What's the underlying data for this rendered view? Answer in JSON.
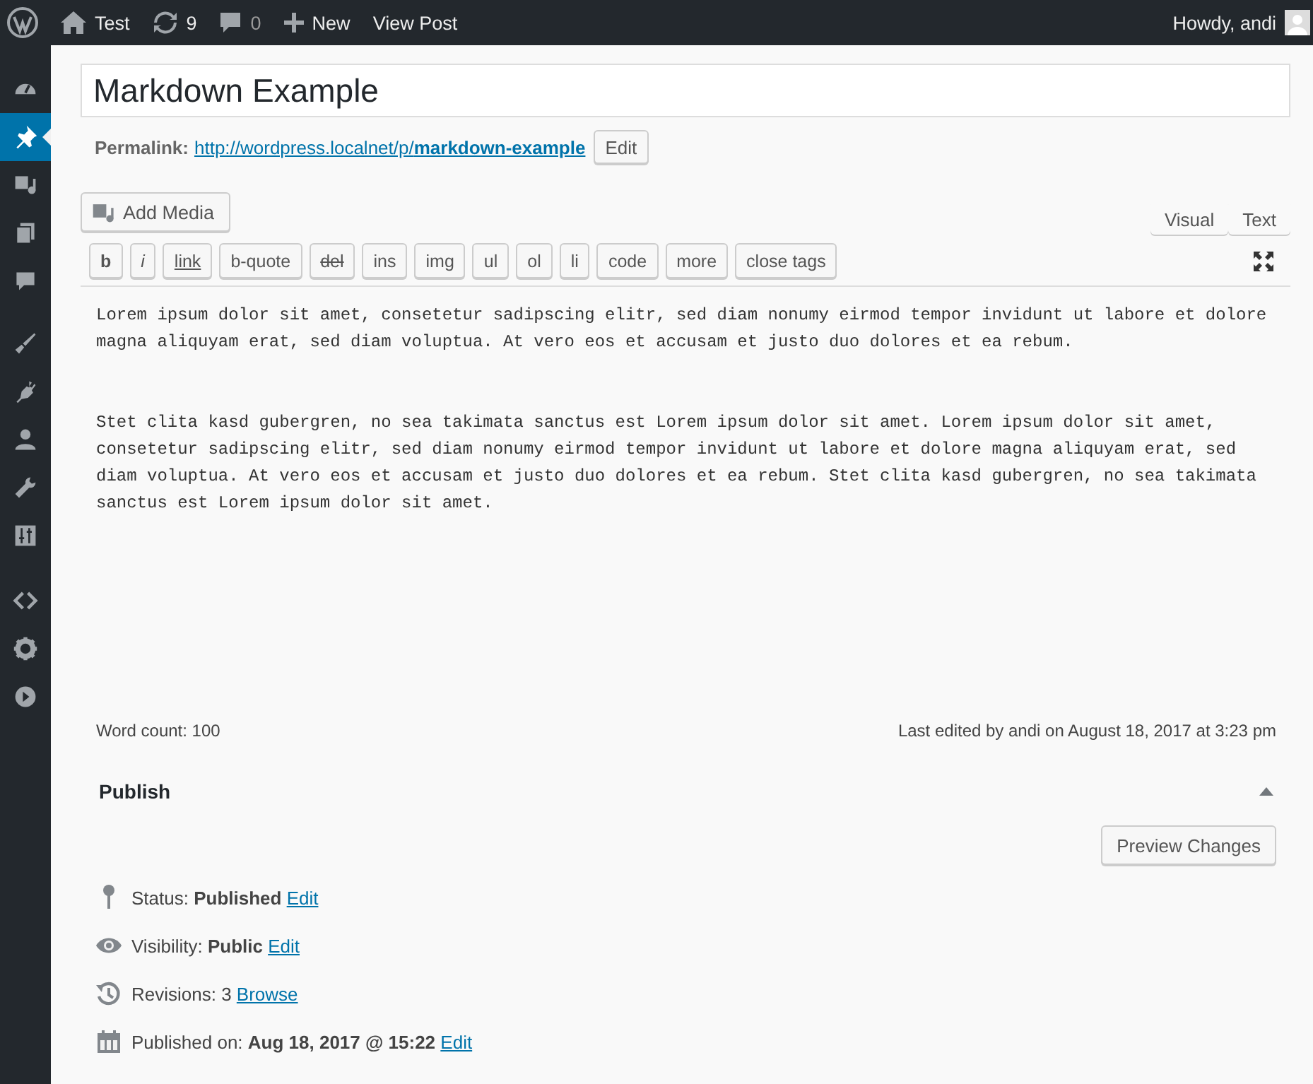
{
  "admin_bar": {
    "site": "Test",
    "updates": "9",
    "comments": "0",
    "new": "New",
    "view_post": "View Post",
    "greeting": "Howdy, andi"
  },
  "sidebar": {
    "items": [
      {
        "selected": false
      },
      {
        "selected": true
      },
      {
        "selected": false
      },
      {
        "selected": false
      },
      {
        "selected": false
      },
      {
        "selected": false
      },
      {
        "selected": false
      },
      {
        "selected": false
      },
      {
        "selected": false
      },
      {
        "selected": false
      },
      {
        "selected": false
      },
      {
        "selected": false
      },
      {
        "selected": false
      }
    ]
  },
  "post": {
    "title": "Markdown Example",
    "permalink_label": "Permalink:",
    "permalink": "http://wordpress.localnet/p/**markdown-example**",
    "permalink_button": "Edit"
  },
  "editor": {
    "add_media": "Add Media",
    "tabs": [
      "Visual",
      "Text"
    ],
    "quicktags": [
      {
        "label": "b",
        "kind": "bold"
      },
      {
        "label": "i",
        "kind": "italic"
      },
      {
        "label": "link",
        "kind": "link"
      },
      {
        "label": "b-quote",
        "kind": "plain"
      },
      {
        "label": "del",
        "kind": "del"
      },
      {
        "label": "ins",
        "kind": "plain"
      },
      {
        "label": "img",
        "kind": "plain"
      },
      {
        "label": "ul",
        "kind": "plain"
      },
      {
        "label": "ol",
        "kind": "plain"
      },
      {
        "label": "li",
        "kind": "plain"
      },
      {
        "label": "code",
        "kind": "plain"
      },
      {
        "label": "more",
        "kind": "plain"
      },
      {
        "label": "close tags",
        "kind": "plain"
      }
    ],
    "content": [
      "Lorem ipsum dolor sit amet, consetetur sadipscing elitr, sed diam nonumy eirmod tempor invidunt ut labore et dolore magna aliquyam erat, sed diam voluptua. At vero eos et accusam et justo duo dolores et ea rebum.",
      "Stet clita kasd gubergren, no sea takimata sanctus est Lorem ipsum dolor sit amet. Lorem ipsum dolor sit amet, consetetur sadipscing elitr, sed diam nonumy eirmod tempor invidunt ut labore et dolore magna aliquyam erat, sed diam voluptua. At vero eos et accusam et justo duo dolores et ea rebum. Stet clita kasd gubergren, no sea takimata sanctus est Lorem ipsum dolor sit amet."
    ],
    "word_count": "Word count: 100",
    "last_edited": "Last edited by andi on August 18, 2017 at 3:23 pm"
  },
  "publish": {
    "title": "Publish",
    "expanded": true,
    "preview_button": "Preview Changes",
    "rows": [
      {
        "kind": "status",
        "text": "Status: **Published**",
        "link": "Edit"
      },
      {
        "kind": "visibility",
        "text": "Visibility: **Public**",
        "link": "Edit"
      },
      {
        "kind": "revisions",
        "text": "Revisions: 3",
        "link": "Browse"
      },
      {
        "kind": "date",
        "text": "Published on: **Aug 18, 2017 @ 15:22**",
        "link": "Edit"
      }
    ]
  }
}
